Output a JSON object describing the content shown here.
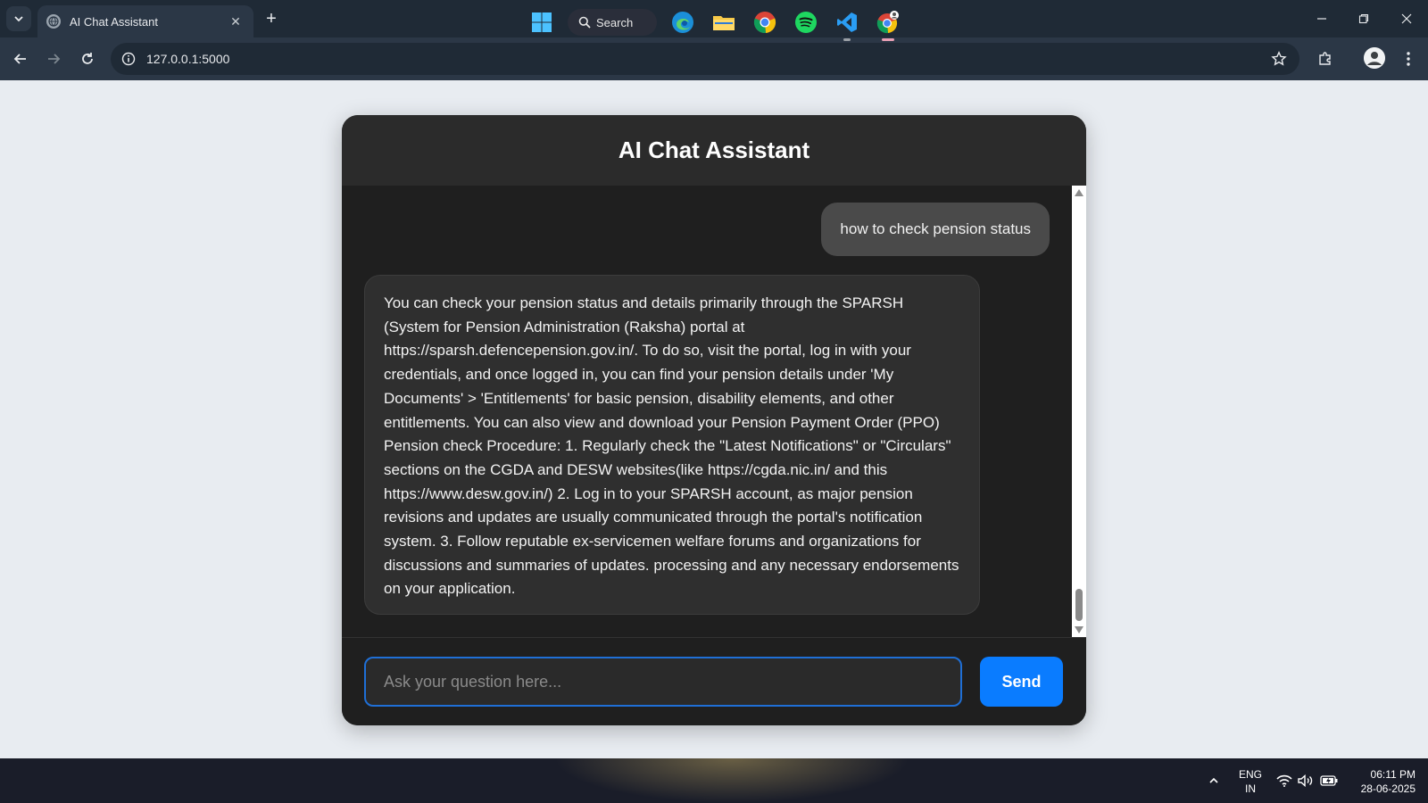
{
  "browser": {
    "tab_title": "AI Chat Assistant",
    "tab_close": "✕",
    "new_tab": "+",
    "url": "127.0.0.1:5000"
  },
  "chat": {
    "title": "AI Chat Assistant",
    "messages": [
      {
        "role": "user",
        "text": "how to check pension status"
      },
      {
        "role": "assistant",
        "text": "You can check your pension status and details primarily through the SPARSH (System for Pension Administration (Raksha) portal at https://sparsh.defencepension.gov.in/. To do so, visit the portal, log in with your credentials, and once logged in, you can find your pension details under 'My Documents' > 'Entitlements' for basic pension, disability elements, and other entitlements. You can also view and download your Pension Payment Order (PPO) Pension check Procedure: 1. Regularly check the \"Latest Notifications\" or \"Circulars\" sections on the CGDA and DESW websites(like https://cgda.nic.in/ and this https://www.desw.gov.in/) 2. Log in to your SPARSH account, as major pension revisions and updates are usually communicated through the portal's notification system. 3. Follow reputable ex-servicemen welfare forums and organizations for discussions and summaries of updates. processing and any necessary endorsements on your application."
      }
    ],
    "input_placeholder": "Ask your question here...",
    "input_value": "",
    "send_label": "Send"
  },
  "taskbar": {
    "search_label": "Search",
    "lang_line1": "ENG",
    "lang_line2": "IN",
    "time": "06:11 PM",
    "date": "28-06-2025"
  },
  "colors": {
    "accent": "#0a7cff",
    "card_bg": "#1f1f1f",
    "header_bg": "#2b2b2b",
    "user_bubble": "#4a4a4a",
    "ai_bubble": "#2f2f2f",
    "page_bg": "#e8ecf1"
  }
}
